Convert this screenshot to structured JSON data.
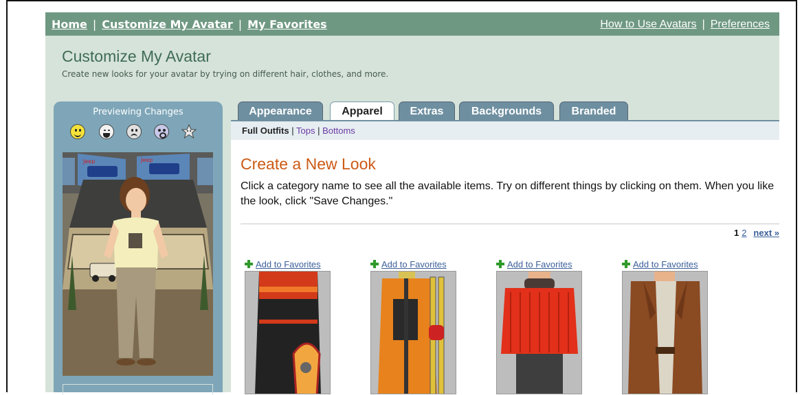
{
  "nav": {
    "home": "Home",
    "customize": "Customize My Avatar",
    "favorites": "My Favorites",
    "sep": "|",
    "how_to": "How to Use Avatars",
    "preferences": "Preferences"
  },
  "page": {
    "title": "Customize My Avatar",
    "subtitle": "Create new looks for your avatar by trying on different hair, clothes, and more."
  },
  "preview": {
    "title": "Previewing Changes",
    "emotes": [
      "happy-face-icon",
      "laughing-face-icon",
      "sad-face-icon",
      "shocked-face-icon",
      "star-face-icon"
    ]
  },
  "tabs": [
    {
      "label": "Appearance",
      "active": false
    },
    {
      "label": "Apparel",
      "active": true
    },
    {
      "label": "Extras",
      "active": false
    },
    {
      "label": "Backgrounds",
      "active": false
    },
    {
      "label": "Branded",
      "active": false
    }
  ],
  "subtabs": {
    "full_outfits": "Full Outfits",
    "tops": "Tops",
    "bottoms": "Bottoms",
    "sep": "|"
  },
  "content": {
    "title": "Create a New Look",
    "description": "Click a category name to see all the available items. Try on different things by clicking on them. When you like the look, click \"Save Changes.\""
  },
  "pager": {
    "current": "1",
    "page2": "2",
    "next": "next »"
  },
  "items": [
    {
      "fav_label": "Add to Favorites",
      "name": "red-black-snowboard-jacket-outfit"
    },
    {
      "fav_label": "Add to Favorites",
      "name": "orange-ski-jacket-outfit"
    },
    {
      "fav_label": "Add to Favorites",
      "name": "red-knit-sweater-outfit"
    },
    {
      "fav_label": "Add to Favorites",
      "name": "brown-leather-coat-outfit"
    }
  ],
  "colors": {
    "nav_bg": "#6f9882",
    "panel_bg": "#d6e3da",
    "tab_bg": "#6e8fa0",
    "title_orange": "#cc5a14",
    "link_blue": "#3b5f9a",
    "link_purple": "#6b3aa0"
  }
}
